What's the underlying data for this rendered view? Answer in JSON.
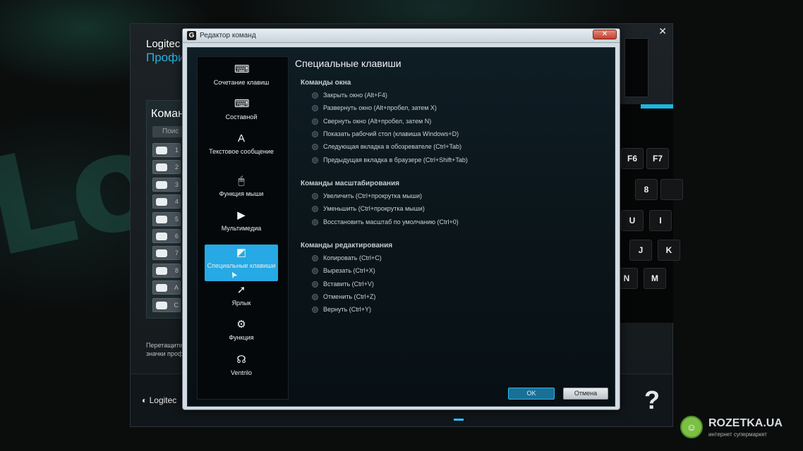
{
  "background": {
    "logo_text": "Log"
  },
  "logitech_window": {
    "title_brand": "Logitec",
    "title_profile": "Профи",
    "panel_title": "Коман",
    "search_placeholder": "Поис",
    "slots": [
      "1",
      "2",
      "3",
      "4",
      "5",
      "6",
      "7",
      "8",
      "A",
      "C"
    ],
    "hint_line1": "Перетащите",
    "hint_line2": "значки проф",
    "footer_logo": "Logitec",
    "footer_help": "?",
    "close": "✕"
  },
  "keyboard": {
    "keys": [
      {
        "label": "F6"
      },
      {
        "label": "F7"
      },
      {
        "label": "8",
        "sub": "•"
      },
      {
        "label": ""
      },
      {
        "label": "U"
      },
      {
        "label": "I"
      },
      {
        "label": "J"
      },
      {
        "label": "K"
      },
      {
        "label": "N"
      },
      {
        "label": "M"
      }
    ]
  },
  "dialog": {
    "title": "Редактор команд",
    "icon_letter": "G",
    "close": "✕",
    "sidebar": [
      {
        "label": "Сочетание клавиш",
        "icon": "key-combo-icon",
        "glyph": "⌨"
      },
      {
        "label": "Составной",
        "icon": "multikey-icon",
        "glyph": "⌨"
      },
      {
        "label": "Текстовое сообщение",
        "icon": "text-icon",
        "glyph": "A"
      },
      {
        "label": "Функция мыши",
        "icon": "mouse-icon",
        "glyph": "🖱"
      },
      {
        "label": "Мультимедиа",
        "icon": "play-icon",
        "glyph": "▶"
      },
      {
        "label": "Специальные клавиши",
        "icon": "special-key-icon",
        "glyph": "◩",
        "active": true
      },
      {
        "label": "Ярлык",
        "icon": "shortcut-arrow-icon",
        "glyph": "➚"
      },
      {
        "label": "Функция",
        "icon": "function-icon",
        "glyph": "⚙"
      },
      {
        "label": "Ventrilo",
        "icon": "headset-icon",
        "glyph": "☊"
      }
    ],
    "heading": "Специальные клавиши",
    "groups": [
      {
        "title": "Команды окна",
        "options": [
          "Закрыть окно (Alt+F4)",
          "Развернуть окно (Alt+пробел, затем X)",
          "Свернуть окно (Alt+пробел, затем N)",
          "Показать рабочий стол (клавиша Windows+D)",
          "Следующая вкладка в обозревателе (Ctrl+Tab)",
          "Предыдущая вкладка в браузере (Ctrl+Shift+Tab)"
        ]
      },
      {
        "title": "Команды масштабирования",
        "options": [
          "Увеличить (Ctrl+прокрутка мыши)",
          "Уменьшить (Ctrl+прокрутка мыши)",
          "Восстановить масштаб по умолчанию (Ctrl+0)"
        ]
      },
      {
        "title": "Команды редактирования",
        "options": [
          "Копировать (Ctrl+C)",
          "Вырезать (Ctrl+X)",
          "Вставить (Ctrl+V)",
          "Отменить (Ctrl+Z)",
          "Вернуть (Ctrl+Y)"
        ]
      }
    ],
    "ok_label": "OK",
    "cancel_label": "Отмена"
  },
  "watermark": {
    "name": "ROZETKA.UA",
    "subtitle": "интернет супермаркет"
  },
  "colors": {
    "accent": "#26a9e4",
    "dialog_bg": "#0a1419"
  }
}
